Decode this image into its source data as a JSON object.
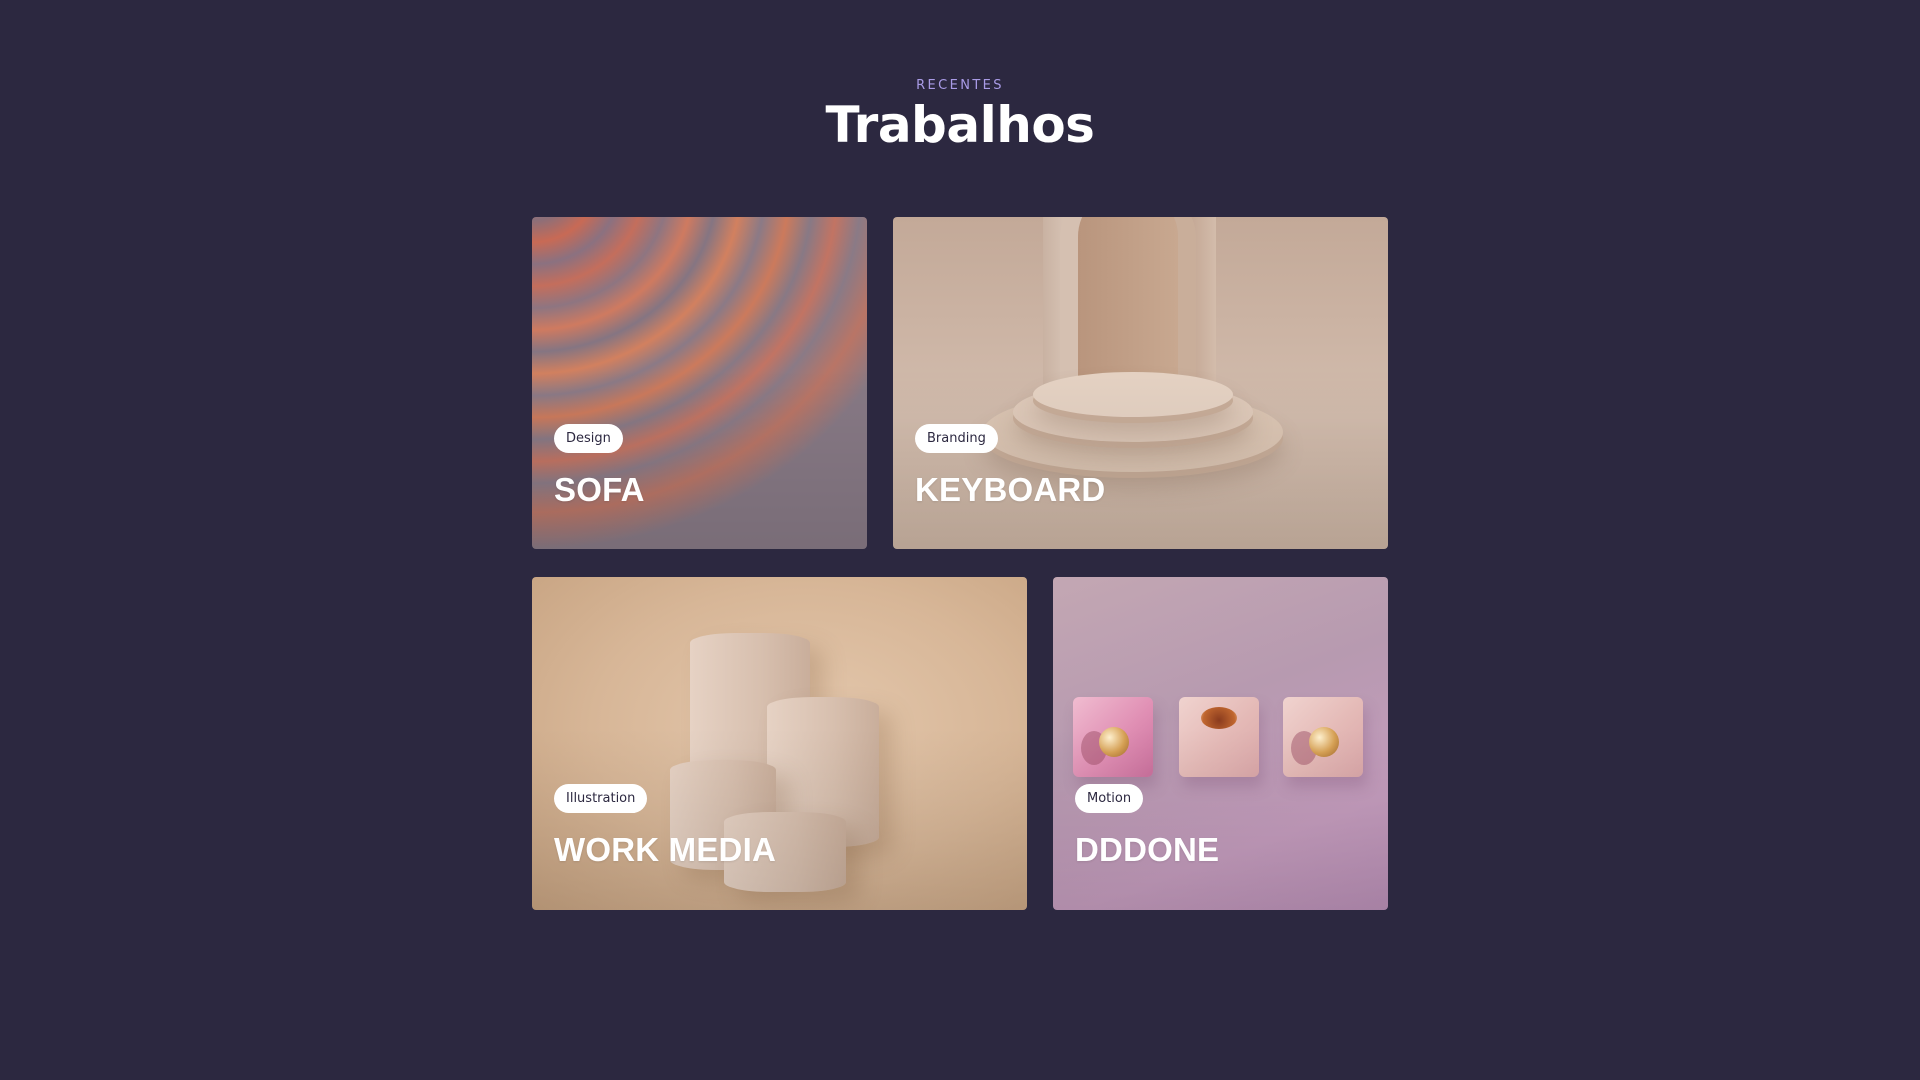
{
  "header": {
    "eyebrow": "RECENTES",
    "title": "Trabalhos"
  },
  "projects": [
    {
      "tag": "Design",
      "title": "SOFA"
    },
    {
      "tag": "Branding",
      "title": "KEYBOARD"
    },
    {
      "tag": "Illustration",
      "title": "WORK MEDIA"
    },
    {
      "tag": "Motion",
      "title": "DDDONE"
    }
  ],
  "colors": {
    "background": "#2c2840",
    "eyebrow": "#a99be6",
    "title": "#ffffff",
    "tag_background": "#ffffff",
    "tag_text": "#2c2840"
  }
}
